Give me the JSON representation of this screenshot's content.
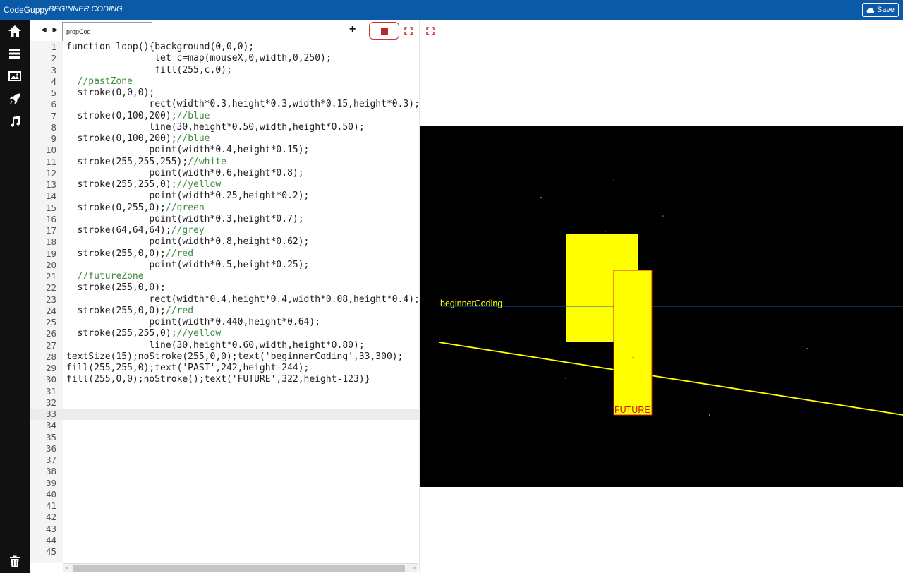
{
  "header": {
    "brand": "CodeGuppy",
    "subtitle": "BEGINNER CODING",
    "save_label": "Save"
  },
  "sidebar": {
    "icons": [
      "home-icon",
      "menu-icon",
      "image-icon",
      "rocket-icon",
      "music-icon",
      "trash-icon"
    ]
  },
  "editor": {
    "tab_label": "propCog",
    "active_line": 33,
    "lines": [
      "function loop(){background(0,0,0);",
      "                let c=map(mouseX,0,width,0,250);",
      "                fill(255,c,0);",
      "  //pastZone",
      "  stroke(0,0,0);",
      "               rect(width*0.3,height*0.3,width*0.15,height*0.3);",
      "  stroke(0,100,200);//blue",
      "               line(30,height*0.50,width,height*0.50);",
      "  stroke(0,100,200);//blue",
      "               point(width*0.4,height*0.15);",
      "  stroke(255,255,255);//white",
      "               point(width*0.6,height*0.8);",
      "  stroke(255,255,0);//yellow",
      "               point(width*0.25,height*0.2);",
      "  stroke(0,255,0);//green",
      "               point(width*0.3,height*0.7);",
      "  stroke(64,64,64);//grey",
      "               point(width*0.8,height*0.62);",
      "  stroke(255,0,0);//red",
      "               point(width*0.5,height*0.25);",
      "  //futureZone",
      "  stroke(255,0,0);",
      "               rect(width*0.4,height*0.4,width*0.08,height*0.4);",
      "  stroke(255,0,0);//red",
      "               point(width*0.440,height*0.64);",
      "  stroke(255,255,0);//yellow",
      "               line(30,height*0.60,width,height*0.80);",
      "textSize(15);noStroke(255,0,0);text('beginnerCoding',33,300);",
      "fill(255,255,0);text('PAST',242,height-244);",
      "fill(255,0,0);noStroke();text('FUTURE',322,height-123)}",
      "",
      "",
      "",
      "",
      "",
      "",
      "",
      "",
      "",
      "",
      "",
      "",
      "",
      "",
      ""
    ]
  },
  "canvas": {
    "label_text": "beginnerCoding",
    "future_text": "FUTURE",
    "colors": {
      "background": "#000000",
      "yellow": "#ffff00",
      "blue": "#0064c8",
      "red": "#ff0000"
    }
  }
}
